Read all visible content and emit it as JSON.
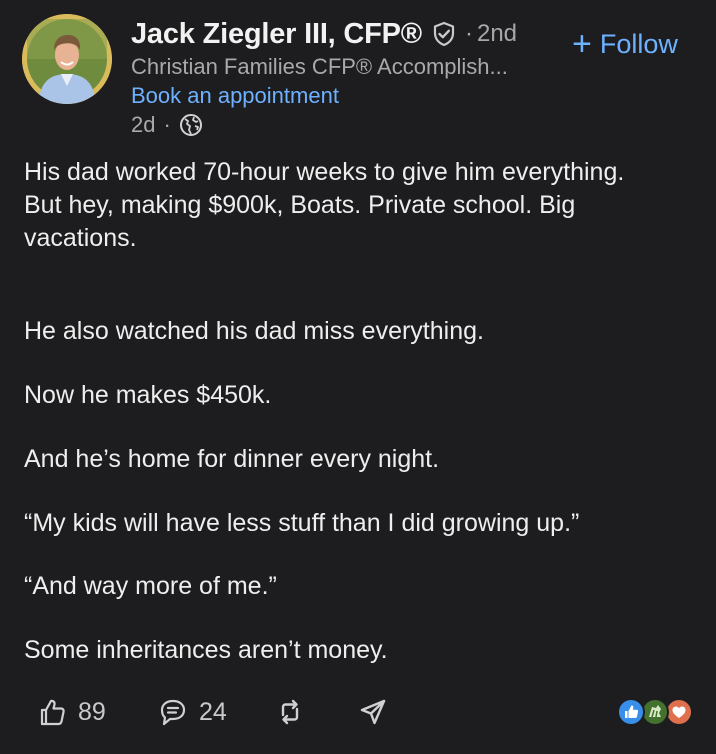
{
  "author": {
    "name": "Jack Ziegler III, CFP®",
    "degree": "2nd",
    "headline": "Christian Families CFP® Accomplish...",
    "cta": "Book an appointment",
    "posted": "2d"
  },
  "follow": {
    "plus": "+",
    "label": "Follow"
  },
  "post": {
    "paragraphs": [
      "His dad worked 70-hour weeks to give him everything.",
      "But hey, making $900k, Boats. Private school. Big",
      "vacations.",
      "He also watched his dad miss everything.",
      "Now he makes $450k.",
      "And he’s home for dinner every night.",
      "“My kids will have less stuff than I did growing up.”",
      "“And way more of me.”",
      "Some inheritances aren’t money."
    ]
  },
  "actions": {
    "likes": "89",
    "comments": "24"
  },
  "icons": {
    "verified": "verified-shield-icon",
    "globe": "globe-icon",
    "like": "thumbs-up-icon",
    "comment": "comment-icon",
    "repost": "repost-icon",
    "send": "send-icon",
    "reactions": [
      "like-reaction-icon",
      "celebrate-reaction-icon",
      "love-reaction-icon"
    ]
  },
  "colors": {
    "background": "#1d1d1f",
    "link": "#6db1ff",
    "muted": "#a9a9ab",
    "text": "#eeeeee",
    "like_reaction": "#378fe9",
    "celebrate_reaction": "#44712e",
    "love_reaction": "#df704d"
  }
}
